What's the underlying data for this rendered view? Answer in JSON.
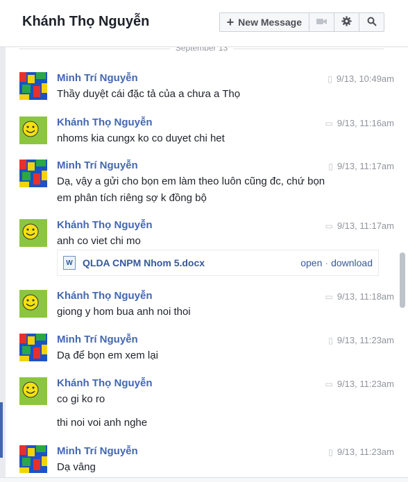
{
  "header": {
    "title": "Khánh Thọ Nguyễn",
    "new_message_label": "New Message",
    "icons": [
      "video-icon",
      "gear-icon",
      "search-icon"
    ]
  },
  "day_separator": "September 13",
  "messages": [
    {
      "sender": "Minh Trí Nguyễn",
      "time": "9/13, 10:49am",
      "device": "mobile",
      "lines": [
        "Thầy duyệt cái đặc tả của a chưa a Thọ"
      ]
    },
    {
      "sender": "Khánh Thọ Nguyễn",
      "time": "9/13, 11:16am",
      "device": "chat",
      "lines": [
        "nhoms kia cungx ko co duyet chi het"
      ]
    },
    {
      "sender": "Minh Trí Nguyễn",
      "time": "9/13, 11:17am",
      "device": "mobile",
      "lines": [
        "Dạ, vậy a gửi cho bọn em làm theo luôn cũng đc, chứ bọn",
        "em phân tích riêng sợ k đồng bộ"
      ]
    },
    {
      "sender": "Khánh Thọ Nguyễn",
      "time": "9/13, 11:17am",
      "device": "chat",
      "lines": [
        "anh co viet chi mo"
      ],
      "attachment": {
        "filename": "QLDA CNPM Nhom 5.docx",
        "open_label": "open",
        "download_label": "download"
      }
    },
    {
      "sender": "Khánh Thọ Nguyễn",
      "time": "9/13, 11:18am",
      "device": "chat",
      "lines": [
        "giong y hom bua anh noi thoi"
      ]
    },
    {
      "sender": "Minh Trí Nguyễn",
      "time": "9/13, 11:23am",
      "device": "mobile",
      "lines": [
        "Dạ để bọn em xem lại"
      ]
    },
    {
      "sender": "Khánh Thọ Nguyễn",
      "time": "9/13, 11:23am",
      "device": "chat",
      "lines": [
        "co gi ko ro",
        "thi noi voi anh nghe"
      ]
    },
    {
      "sender": "Minh Trí Nguyễn",
      "time": "9/13, 11:23am",
      "device": "mobile",
      "lines": [
        "Dạ vâng"
      ]
    }
  ],
  "colors": {
    "sender_name": "#4267b2",
    "text": "#1d2129",
    "meta": "#90949c"
  }
}
